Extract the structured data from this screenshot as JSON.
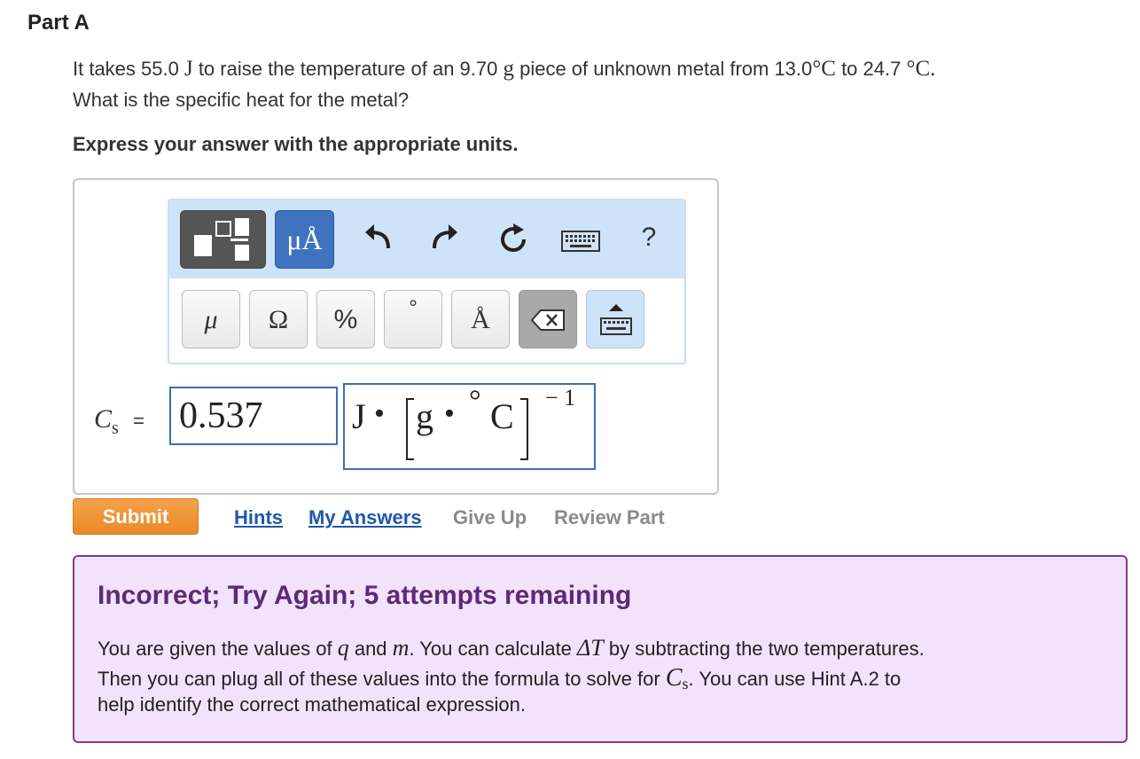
{
  "part": {
    "title": "Part A"
  },
  "question": {
    "line1": {
      "t1": "It takes 55.0 ",
      "m1": "J",
      "t2": " to raise the temperature of an 9.70 ",
      "m2": "g",
      "t3": " piece of unknown metal from 13.0",
      "m3": "°C",
      "t4": " to 24.7 ",
      "m4": "°C",
      "t5": "."
    },
    "line2": "What is the specific heat for the metal?",
    "instruction": "Express your answer with the appropriate units."
  },
  "toolbar": {
    "units_label": "μÅ",
    "undo_glyph": "↶",
    "redo_glyph": "↷",
    "reset_glyph": "↻",
    "help_label": "?",
    "keys": [
      "μ",
      "Ω",
      "%",
      "°",
      "Å",
      "⌫",
      "⌨"
    ]
  },
  "answer": {
    "variable": "C",
    "subscript": "s",
    "equals": "=",
    "value": "0.537",
    "unit_J": "J",
    "unit_dot": "•",
    "unit_g": "g",
    "unit_deg": "°",
    "unit_C": "C",
    "unit_exp": "− 1"
  },
  "actions": {
    "submit": "Submit",
    "hints": "Hints",
    "my_answers": "My Answers",
    "give_up": "Give Up",
    "review_part": "Review Part"
  },
  "feedback": {
    "title": "Incorrect; Try Again; 5 attempts remaining",
    "l1a": "You are given the values of ",
    "q": "q",
    "l1b": " and ",
    "m": "m",
    "l1c": ". You can calculate ",
    "dT": "ΔT",
    "l1d": " by subtracting the two temperatures.",
    "l2a": "Then you can plug all of these values into the formula to solve for ",
    "Cs_C": "C",
    "Cs_s": "s",
    "l2b": ". You can use Hint A.2 to",
    "line3": "help identify the correct mathematical expression."
  },
  "colors": {
    "accent_blue": "#3f73c0",
    "submit_orange": "#ea8a28",
    "feedback_bg": "#f3e2fb",
    "feedback_border": "#7a3d91",
    "link": "#1f57a8"
  }
}
